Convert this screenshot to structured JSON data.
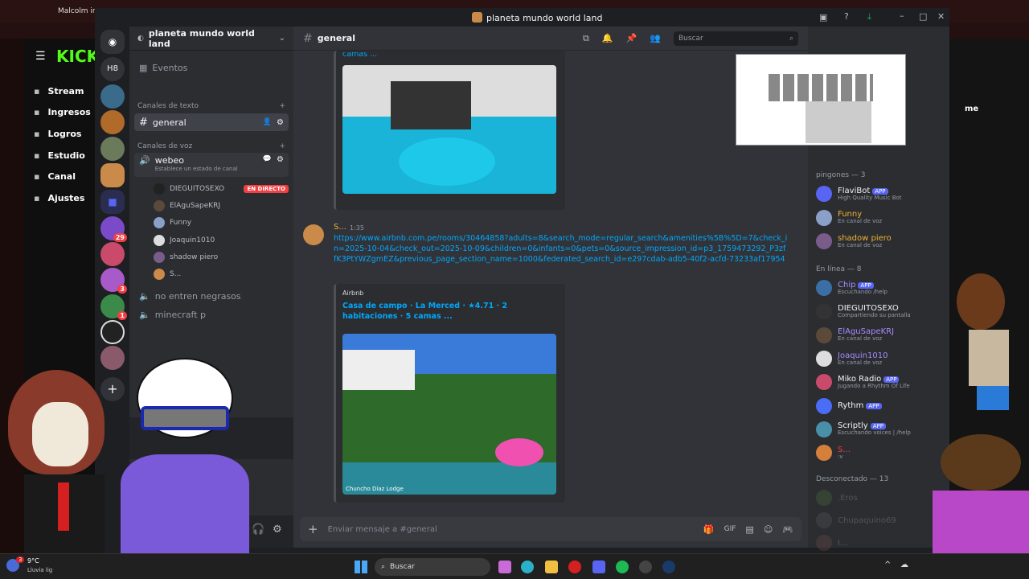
{
  "browser": {
    "tab_title": "Malcolm in",
    "kick_nav": [
      {
        "label": "Stream",
        "icon": "stream-icon"
      },
      {
        "label": "Ingresos",
        "icon": "revenue-icon"
      },
      {
        "label": "Logros",
        "icon": "trophy-icon"
      },
      {
        "label": "Estudio",
        "icon": "studio-icon"
      },
      {
        "label": "Canal",
        "icon": "channel-icon"
      },
      {
        "label": "Ajustes",
        "icon": "settings-icon"
      }
    ],
    "kick_logo": "KICK",
    "right_panel_text": "me"
  },
  "discord": {
    "window_title": "planeta mundo world land",
    "server_name": "planeta mundo world land",
    "guild_badges": {
      "g8": "29",
      "g10": "3",
      "g11": "1"
    },
    "guild_h8": "H8",
    "events_label": "Eventos",
    "text_channels_header": "Canales de texto",
    "text_channels": [
      {
        "name": "general"
      }
    ],
    "voice_channels_header": "Canales de voz",
    "voice_channel_active": {
      "name": "webeo",
      "status": "Establece un estado de canal"
    },
    "voice_users": [
      {
        "name": "DIEGUITOSEXO",
        "live": "EN DIRECTO"
      },
      {
        "name": "ElAguSapeKRJ"
      },
      {
        "name": "Funny"
      },
      {
        "name": "Joaquin1010"
      },
      {
        "name": "shadow piero"
      },
      {
        "name": "S..."
      }
    ],
    "other_voice_channels": [
      "no entren negrasos",
      "minecraft p"
    ],
    "channel_header": "general",
    "search_placeholder": "Buscar",
    "messages": [
      {
        "author": "S...",
        "time": "1:35",
        "link": "https://www.airbnb.com.pe/rooms/30464858?adults=8&search_mode=regular_search&amenities%5B%5D=7&check_in=2025-10-04&check_out=2025-10-09&children=0&infants=0&pets=0&source_impression_id=p3_1759473292_P3zffK3PtYWZgmEZ&previous_page_section_name=1000&federated_search_id=e297cdab-adb5-40f2-acfd-73233af17954",
        "embed_provider": "Airbnb",
        "embed_title": "Casa de campo · La Merced · ★4.71 · 2 habitaciones · 5 camas ...",
        "image_caption": "Chuncho Diaz Lodge"
      }
    ],
    "previous_embed_title_tail": "camas ...",
    "composer_placeholder": "Enviar mensaje a #general",
    "members": {
      "pingones_header": "pingones — 3",
      "pingones": [
        {
          "name": "FlaviBot",
          "app": "APP",
          "sub": "High Quality Music Bot",
          "color": "#5865f2",
          "namecolor": "#f2f3f5"
        },
        {
          "name": "Funny",
          "sub": "En canal de voz",
          "color": "#8aa0c8",
          "namecolor": "#f0b232"
        },
        {
          "name": "shadow piero",
          "sub": "En canal de voz",
          "color": "#7a5c8a",
          "namecolor": "#f0b232"
        }
      ],
      "online_header": "En línea — 8",
      "online": [
        {
          "name": "Chip",
          "app": "APP",
          "sub": "Escuchando /help",
          "color": "#3b6ea5",
          "namecolor": "#a78bfa"
        },
        {
          "name": "DIEGUITOSEXO",
          "sub": "Compartiendo su pantalla",
          "color": "#333333",
          "namecolor": "#f2f3f5"
        },
        {
          "name": "ElAguSapeKRJ",
          "sub": "En canal de voz",
          "color": "#5b4a3a",
          "namecolor": "#a78bfa"
        },
        {
          "name": "Joaquin1010",
          "sub": "En canal de voz",
          "color": "#ddd",
          "namecolor": "#a78bfa"
        },
        {
          "name": "Miko Radio",
          "app": "APP",
          "sub": "Jugando a Rhythm Of Life",
          "color": "#c94a6a",
          "namecolor": "#f2f3f5"
        },
        {
          "name": "Rythm",
          "app": "APP",
          "sub": "",
          "color": "#4a6cf7",
          "namecolor": "#f2f3f5"
        },
        {
          "name": "Scriptly",
          "app": "APP",
          "sub": "Escuchando voices | /help",
          "color": "#4a8fa8",
          "namecolor": "#f2f3f5"
        },
        {
          "name": "S...",
          "sub": ":v",
          "color": "#d4803a",
          "namecolor": "#f23f43"
        }
      ],
      "offline_header": "Desconectado — 13",
      "offline": [
        {
          "name": ".Eros",
          "color": "#4a6a3a"
        },
        {
          "name": "Chupaquino69",
          "color": "#555555"
        },
        {
          "name": "I...",
          "color": "#6a4a4a"
        }
      ]
    },
    "colors": {
      "blurple": "#5865f2",
      "link": "#00a8fc",
      "live": "#f23f43",
      "green": "#23a55a"
    }
  },
  "taskbar": {
    "weather_temp": "9°C",
    "weather_desc": "Lluvia lig",
    "search_label": "Buscar",
    "weather_badge": "3"
  }
}
